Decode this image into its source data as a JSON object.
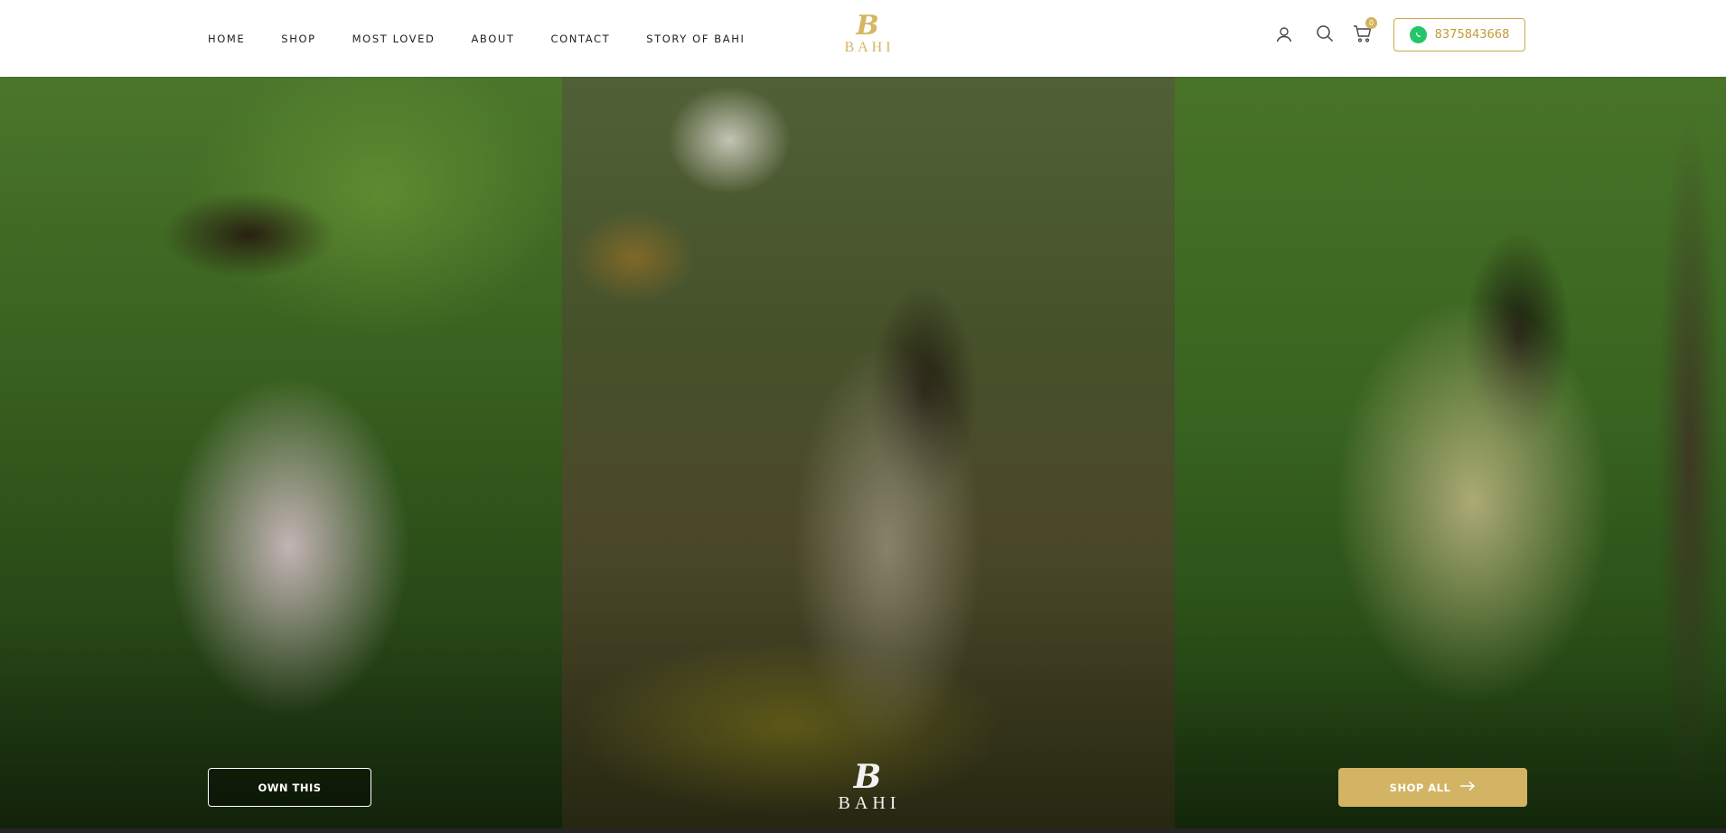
{
  "nav": {
    "items": [
      {
        "label": "HOME"
      },
      {
        "label": "SHOP"
      },
      {
        "label": "MOST LOVED"
      },
      {
        "label": "ABOUT"
      },
      {
        "label": "CONTACT"
      },
      {
        "label": "STORY OF BAHI"
      }
    ]
  },
  "brand": {
    "mark": "B",
    "wordmark": "BAHI",
    "color": "#d4b760"
  },
  "header": {
    "icons": [
      "user-icon",
      "search-icon",
      "cart-icon"
    ],
    "cart_count": "0",
    "phone": "8375843668",
    "phone_icon": "whatsapp-icon"
  },
  "hero": {
    "own_button": "OWN THIS",
    "shop_button": "SHOP ALL",
    "shop_button_color": "#d2b464"
  }
}
